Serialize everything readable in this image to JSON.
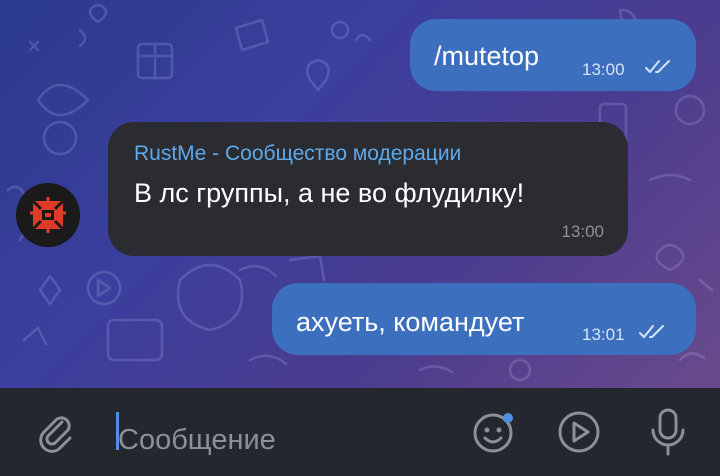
{
  "messages": [
    {
      "id": "msg1",
      "type": "outgoing",
      "text": "/mutetop",
      "time": "13:00",
      "status": "read"
    },
    {
      "id": "msg2",
      "type": "incoming",
      "sender": "RustMe - Сообщество модерации",
      "text": "В лс группы, а не во флудилку!",
      "time": "13:00"
    },
    {
      "id": "msg3",
      "type": "outgoing",
      "text": "ахуеть, командует",
      "time": "13:01",
      "status": "read"
    }
  ],
  "input": {
    "placeholder": "Сообщение",
    "value": ""
  },
  "icons": {
    "attach": "paperclip-icon",
    "emoji": "emoji-icon",
    "video": "video-message-icon",
    "mic": "microphone-icon",
    "read": "double-check-icon"
  },
  "colors": {
    "outgoing_bubble": "#3d6fbf",
    "incoming_bubble": "#2a2c32",
    "sender_name": "#5fa8e8",
    "input_bar": "#24272e",
    "accent": "#4f8fe0"
  }
}
